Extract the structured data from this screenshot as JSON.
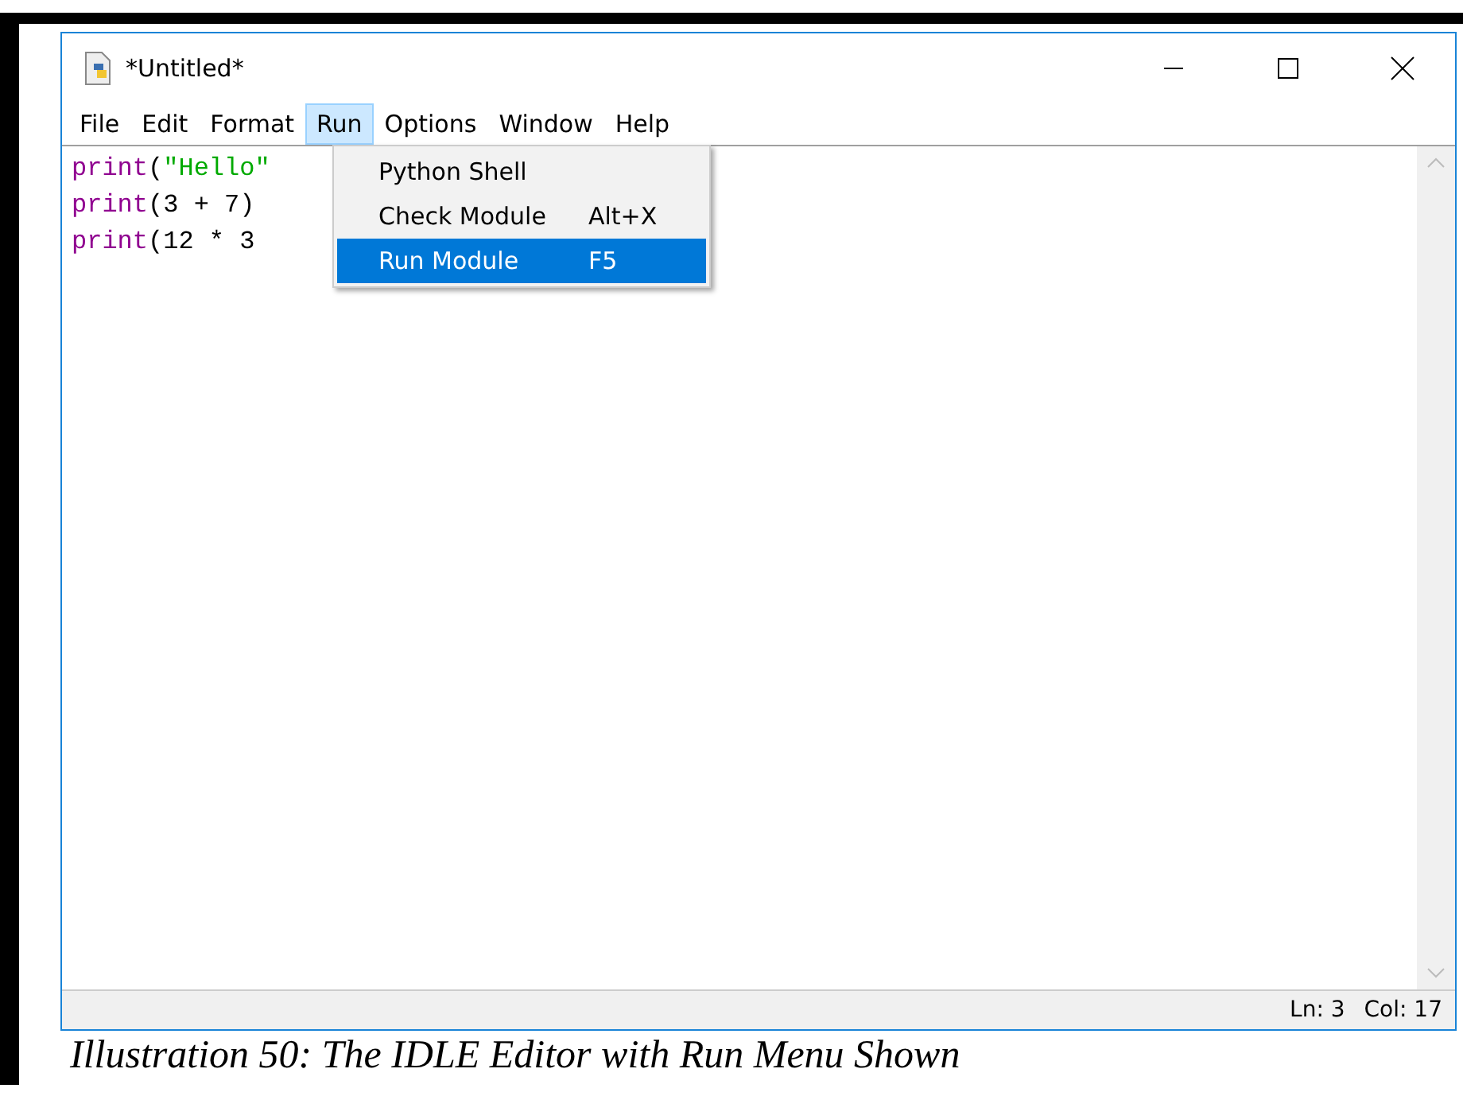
{
  "window": {
    "title": "*Untitled*"
  },
  "menu_bar": [
    {
      "label": "File",
      "selected": false
    },
    {
      "label": "Edit",
      "selected": false
    },
    {
      "label": "Format",
      "selected": false
    },
    {
      "label": "Run",
      "selected": true
    },
    {
      "label": "Options",
      "selected": false
    },
    {
      "label": "Window",
      "selected": false
    },
    {
      "label": "Help",
      "selected": false
    }
  ],
  "run_menu": [
    {
      "label": "Python Shell",
      "selected": false
    },
    {
      "label": "Check Module",
      "shortcut": "Alt+X",
      "selected": false
    },
    {
      "label": "Run Module",
      "shortcut": "F5",
      "selected": true
    }
  ],
  "editor": {
    "lines": [
      [
        {
          "kind": "builtin",
          "text": "print"
        },
        {
          "kind": "plain",
          "text": "("
        },
        {
          "kind": "string",
          "text": "\"Hello\""
        }
      ],
      [
        {
          "kind": "builtin",
          "text": "print"
        },
        {
          "kind": "plain",
          "text": "(3 + 7)"
        }
      ],
      [
        {
          "kind": "builtin",
          "text": "print"
        },
        {
          "kind": "plain",
          "text": "(12 * 3"
        }
      ]
    ]
  },
  "status_bar": {
    "line": "Ln: 3",
    "column": "Col: 17"
  },
  "caption": "Illustration 50: The IDLE Editor with Run Menu Shown"
}
